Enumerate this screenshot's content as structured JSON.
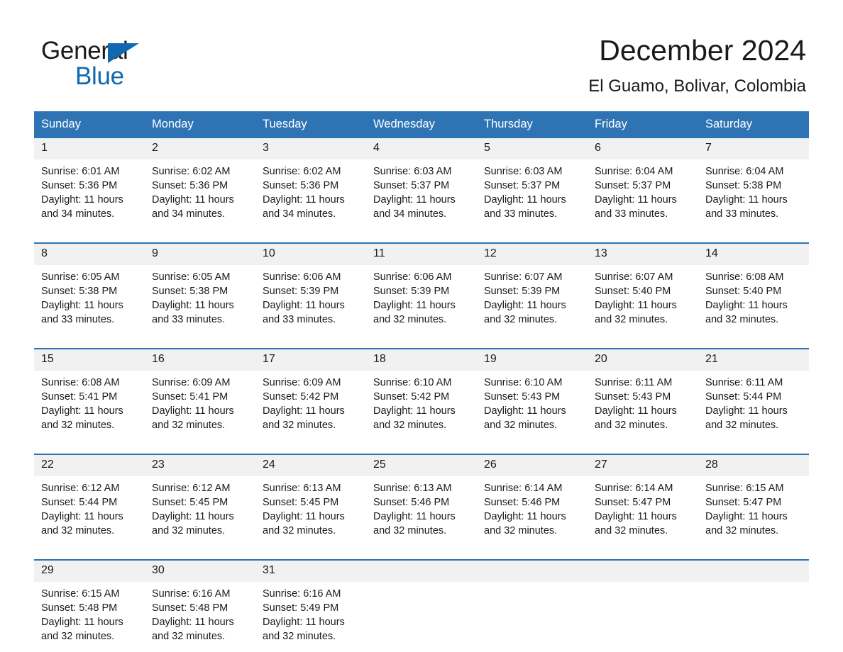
{
  "brand": {
    "name_part1": "General",
    "name_part2": "Blue",
    "triangle_color": "#0f68b0"
  },
  "header": {
    "month_title": "December 2024",
    "location": "El Guamo, Bolivar, Colombia"
  },
  "theme": {
    "header_blue": "#2e74b5",
    "daynum_band": "#f1f1f1",
    "text": "#1a1a1a"
  },
  "weekday_headers": [
    "Sunday",
    "Monday",
    "Tuesday",
    "Wednesday",
    "Thursday",
    "Friday",
    "Saturday"
  ],
  "weeks": [
    {
      "days": [
        {
          "num": "1",
          "sunrise": "Sunrise: 6:01 AM",
          "sunset": "Sunset: 5:36 PM",
          "daylight": "Daylight: 11 hours and 34 minutes."
        },
        {
          "num": "2",
          "sunrise": "Sunrise: 6:02 AM",
          "sunset": "Sunset: 5:36 PM",
          "daylight": "Daylight: 11 hours and 34 minutes."
        },
        {
          "num": "3",
          "sunrise": "Sunrise: 6:02 AM",
          "sunset": "Sunset: 5:36 PM",
          "daylight": "Daylight: 11 hours and 34 minutes."
        },
        {
          "num": "4",
          "sunrise": "Sunrise: 6:03 AM",
          "sunset": "Sunset: 5:37 PM",
          "daylight": "Daylight: 11 hours and 34 minutes."
        },
        {
          "num": "5",
          "sunrise": "Sunrise: 6:03 AM",
          "sunset": "Sunset: 5:37 PM",
          "daylight": "Daylight: 11 hours and 33 minutes."
        },
        {
          "num": "6",
          "sunrise": "Sunrise: 6:04 AM",
          "sunset": "Sunset: 5:37 PM",
          "daylight": "Daylight: 11 hours and 33 minutes."
        },
        {
          "num": "7",
          "sunrise": "Sunrise: 6:04 AM",
          "sunset": "Sunset: 5:38 PM",
          "daylight": "Daylight: 11 hours and 33 minutes."
        }
      ]
    },
    {
      "days": [
        {
          "num": "8",
          "sunrise": "Sunrise: 6:05 AM",
          "sunset": "Sunset: 5:38 PM",
          "daylight": "Daylight: 11 hours and 33 minutes."
        },
        {
          "num": "9",
          "sunrise": "Sunrise: 6:05 AM",
          "sunset": "Sunset: 5:38 PM",
          "daylight": "Daylight: 11 hours and 33 minutes."
        },
        {
          "num": "10",
          "sunrise": "Sunrise: 6:06 AM",
          "sunset": "Sunset: 5:39 PM",
          "daylight": "Daylight: 11 hours and 33 minutes."
        },
        {
          "num": "11",
          "sunrise": "Sunrise: 6:06 AM",
          "sunset": "Sunset: 5:39 PM",
          "daylight": "Daylight: 11 hours and 32 minutes."
        },
        {
          "num": "12",
          "sunrise": "Sunrise: 6:07 AM",
          "sunset": "Sunset: 5:39 PM",
          "daylight": "Daylight: 11 hours and 32 minutes."
        },
        {
          "num": "13",
          "sunrise": "Sunrise: 6:07 AM",
          "sunset": "Sunset: 5:40 PM",
          "daylight": "Daylight: 11 hours and 32 minutes."
        },
        {
          "num": "14",
          "sunrise": "Sunrise: 6:08 AM",
          "sunset": "Sunset: 5:40 PM",
          "daylight": "Daylight: 11 hours and 32 minutes."
        }
      ]
    },
    {
      "days": [
        {
          "num": "15",
          "sunrise": "Sunrise: 6:08 AM",
          "sunset": "Sunset: 5:41 PM",
          "daylight": "Daylight: 11 hours and 32 minutes."
        },
        {
          "num": "16",
          "sunrise": "Sunrise: 6:09 AM",
          "sunset": "Sunset: 5:41 PM",
          "daylight": "Daylight: 11 hours and 32 minutes."
        },
        {
          "num": "17",
          "sunrise": "Sunrise: 6:09 AM",
          "sunset": "Sunset: 5:42 PM",
          "daylight": "Daylight: 11 hours and 32 minutes."
        },
        {
          "num": "18",
          "sunrise": "Sunrise: 6:10 AM",
          "sunset": "Sunset: 5:42 PM",
          "daylight": "Daylight: 11 hours and 32 minutes."
        },
        {
          "num": "19",
          "sunrise": "Sunrise: 6:10 AM",
          "sunset": "Sunset: 5:43 PM",
          "daylight": "Daylight: 11 hours and 32 minutes."
        },
        {
          "num": "20",
          "sunrise": "Sunrise: 6:11 AM",
          "sunset": "Sunset: 5:43 PM",
          "daylight": "Daylight: 11 hours and 32 minutes."
        },
        {
          "num": "21",
          "sunrise": "Sunrise: 6:11 AM",
          "sunset": "Sunset: 5:44 PM",
          "daylight": "Daylight: 11 hours and 32 minutes."
        }
      ]
    },
    {
      "days": [
        {
          "num": "22",
          "sunrise": "Sunrise: 6:12 AM",
          "sunset": "Sunset: 5:44 PM",
          "daylight": "Daylight: 11 hours and 32 minutes."
        },
        {
          "num": "23",
          "sunrise": "Sunrise: 6:12 AM",
          "sunset": "Sunset: 5:45 PM",
          "daylight": "Daylight: 11 hours and 32 minutes."
        },
        {
          "num": "24",
          "sunrise": "Sunrise: 6:13 AM",
          "sunset": "Sunset: 5:45 PM",
          "daylight": "Daylight: 11 hours and 32 minutes."
        },
        {
          "num": "25",
          "sunrise": "Sunrise: 6:13 AM",
          "sunset": "Sunset: 5:46 PM",
          "daylight": "Daylight: 11 hours and 32 minutes."
        },
        {
          "num": "26",
          "sunrise": "Sunrise: 6:14 AM",
          "sunset": "Sunset: 5:46 PM",
          "daylight": "Daylight: 11 hours and 32 minutes."
        },
        {
          "num": "27",
          "sunrise": "Sunrise: 6:14 AM",
          "sunset": "Sunset: 5:47 PM",
          "daylight": "Daylight: 11 hours and 32 minutes."
        },
        {
          "num": "28",
          "sunrise": "Sunrise: 6:15 AM",
          "sunset": "Sunset: 5:47 PM",
          "daylight": "Daylight: 11 hours and 32 minutes."
        }
      ]
    },
    {
      "days": [
        {
          "num": "29",
          "sunrise": "Sunrise: 6:15 AM",
          "sunset": "Sunset: 5:48 PM",
          "daylight": "Daylight: 11 hours and 32 minutes."
        },
        {
          "num": "30",
          "sunrise": "Sunrise: 6:16 AM",
          "sunset": "Sunset: 5:48 PM",
          "daylight": "Daylight: 11 hours and 32 minutes."
        },
        {
          "num": "31",
          "sunrise": "Sunrise: 6:16 AM",
          "sunset": "Sunset: 5:49 PM",
          "daylight": "Daylight: 11 hours and 32 minutes."
        },
        {
          "num": "",
          "sunrise": "",
          "sunset": "",
          "daylight": ""
        },
        {
          "num": "",
          "sunrise": "",
          "sunset": "",
          "daylight": ""
        },
        {
          "num": "",
          "sunrise": "",
          "sunset": "",
          "daylight": ""
        },
        {
          "num": "",
          "sunrise": "",
          "sunset": "",
          "daylight": ""
        }
      ]
    }
  ]
}
